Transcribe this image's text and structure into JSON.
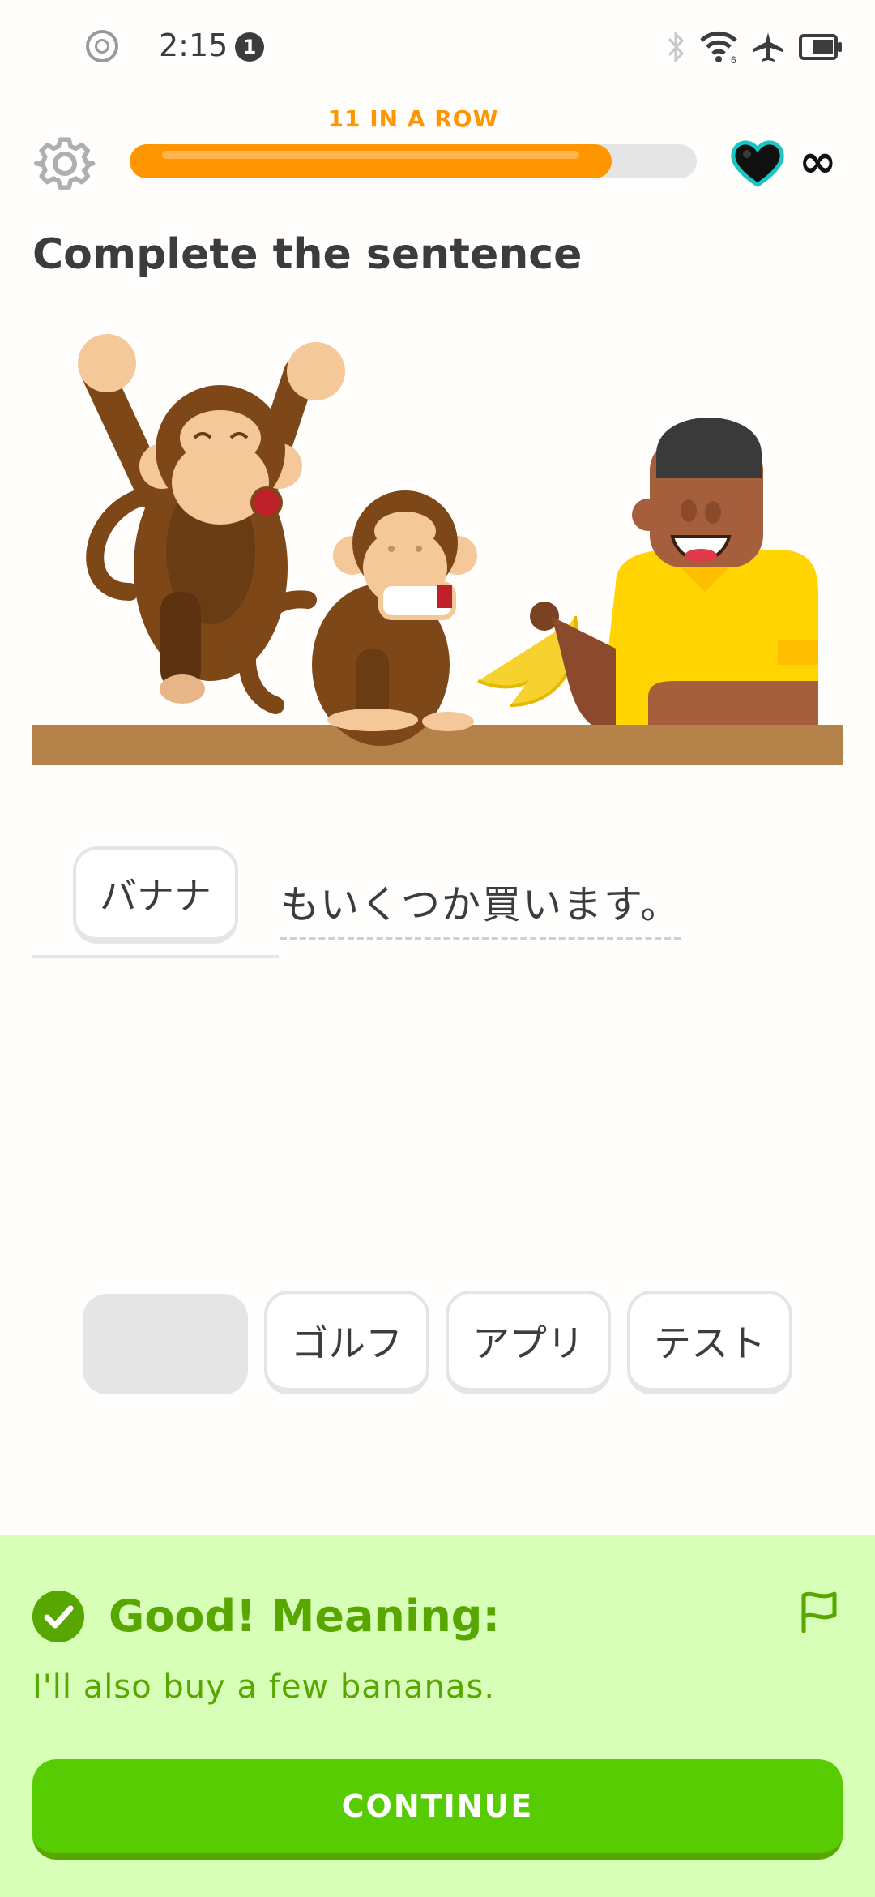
{
  "status_bar": {
    "time": "2:15",
    "notification_count": "1",
    "icons": [
      "bluetooth-icon",
      "wifi-icon",
      "airplane-icon",
      "battery-icon"
    ]
  },
  "header": {
    "streak_label": "11 IN A ROW",
    "progress": 0.85,
    "hearts": "∞",
    "colors": {
      "accent": "#ff9600",
      "track": "#e5e5e5"
    }
  },
  "prompt": {
    "title": "Complete the sentence"
  },
  "sentence": {
    "filled_word": "バナナ",
    "rest": "もいくつか買います。"
  },
  "word_bank": [
    "ゴルフ",
    "アプリ",
    "テスト"
  ],
  "feedback": {
    "title": "Good! Meaning:",
    "translation": "I'll also buy a few bananas.",
    "continue_label": "CONTINUE",
    "colors": {
      "bg": "#d7ffb8",
      "text": "#58a700",
      "button": "#58cc02"
    }
  }
}
